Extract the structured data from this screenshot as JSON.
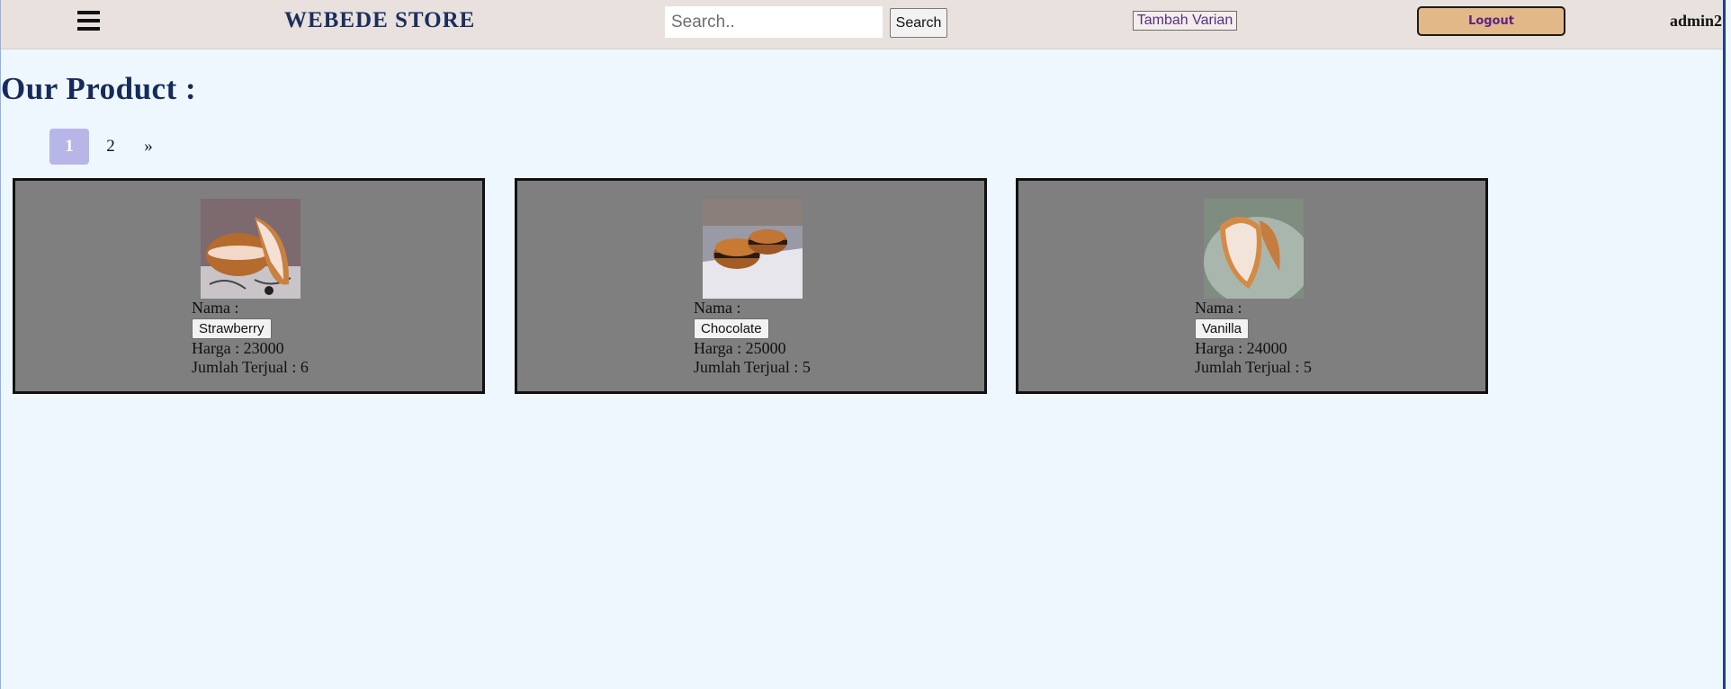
{
  "header": {
    "brand": "WEBEDE STORE",
    "search_placeholder": "Search..",
    "search_button": "Search",
    "add_variant_button": "Tambah Varian",
    "logout_button": "Logout",
    "username": "admin2"
  },
  "page_title": "Our Product :",
  "pagination": {
    "pages": [
      "1",
      "2",
      "»"
    ],
    "active": "1"
  },
  "products": [
    {
      "name_label": "Nama :",
      "name": "Strawberry",
      "price_text": "Harga : 23000",
      "sold_text": "Jumlah Terjual : 6",
      "image": "dorayaki-strawberry"
    },
    {
      "name_label": "Nama :",
      "name": "Chocolate",
      "price_text": "Harga : 25000",
      "sold_text": "Jumlah Terjual : 5",
      "image": "dorayaki-chocolate"
    },
    {
      "name_label": "Nama :",
      "name": "Vanilla",
      "price_text": "Harga : 24000",
      "sold_text": "Jumlah Terjual : 5",
      "image": "dorayaki-vanilla"
    }
  ],
  "colors": {
    "header_bg": "#e8e1dd",
    "page_bg": "#eef7fd",
    "brand": "#1b2e5e",
    "card_bg": "#7f7f7f",
    "logout_bg": "#e3b889",
    "active_page": "#b8b6e6"
  }
}
